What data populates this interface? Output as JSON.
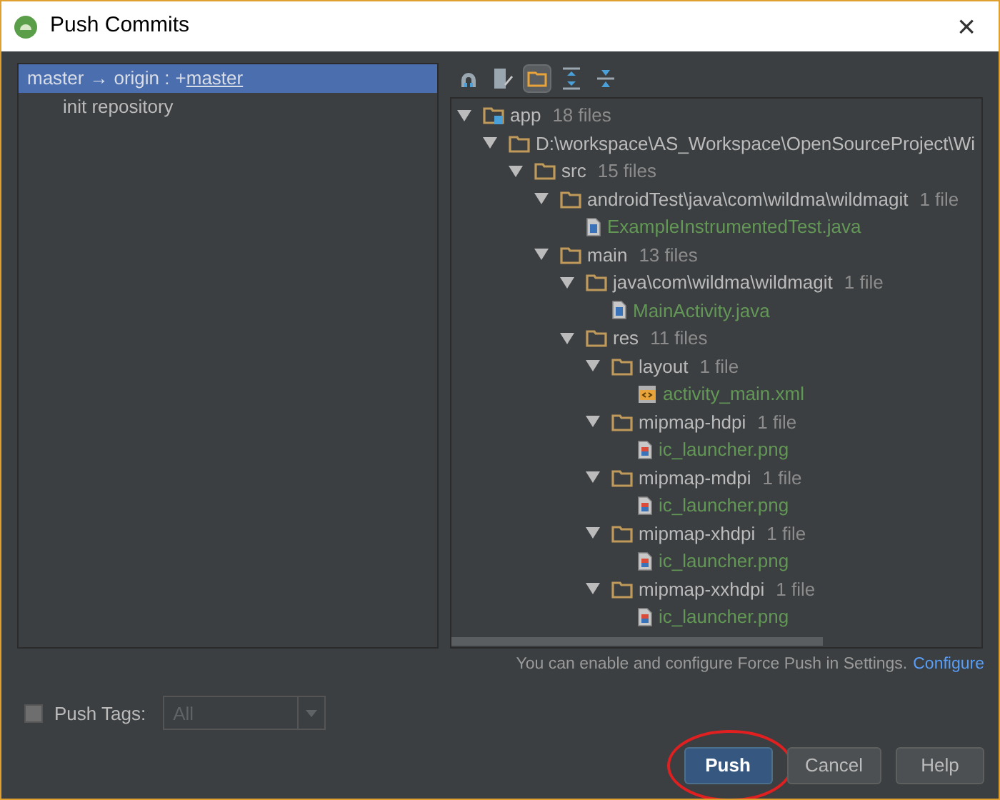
{
  "window": {
    "title": "Push Commits",
    "close": "×"
  },
  "commits": [
    {
      "kind": "branch",
      "parts": [
        "master",
        "→",
        "origin :",
        "+"
      ],
      "link": "master",
      "selected": true
    },
    {
      "kind": "commit",
      "text": "init repository",
      "selected": false
    }
  ],
  "toolbar": [
    {
      "kind": "cloud",
      "selected": false
    },
    {
      "kind": "edit",
      "selected": false
    },
    {
      "kind": "group",
      "selected": true
    },
    {
      "kind": "expand",
      "selected": false
    },
    {
      "kind": "collapse",
      "selected": false
    }
  ],
  "tree": [
    {
      "kind": "module",
      "name": "app",
      "count": "18 files",
      "expanded": true,
      "children": [
        {
          "kind": "folder",
          "name": "D:\\workspace\\AS_Workspace\\OpenSourceProject\\Wi",
          "expanded": true,
          "children": [
            {
              "kind": "folder",
              "name": "src",
              "count": "15 files",
              "expanded": true,
              "children": [
                {
                  "kind": "folder",
                  "name": "androidTest\\java\\com\\wildma\\wildmagit",
                  "count": "1 file",
                  "expanded": true,
                  "children": [
                    {
                      "kind": "java",
                      "name": "ExampleInstrumentedTest.java"
                    }
                  ]
                },
                {
                  "kind": "folder",
                  "name": "main",
                  "count": "13 files",
                  "expanded": true,
                  "children": [
                    {
                      "kind": "folder",
                      "name": "java\\com\\wildma\\wildmagit",
                      "count": "1 file",
                      "expanded": true,
                      "children": [
                        {
                          "kind": "java",
                          "name": "MainActivity.java"
                        }
                      ]
                    },
                    {
                      "kind": "folder",
                      "name": "res",
                      "count": "11 files",
                      "expanded": true,
                      "children": [
                        {
                          "kind": "folder",
                          "name": "layout",
                          "count": "1 file",
                          "expanded": true,
                          "children": [
                            {
                              "kind": "xml",
                              "name": "activity_main.xml"
                            }
                          ]
                        },
                        {
                          "kind": "folder",
                          "name": "mipmap-hdpi",
                          "count": "1 file",
                          "expanded": true,
                          "children": [
                            {
                              "kind": "png",
                              "name": "ic_launcher.png"
                            }
                          ]
                        },
                        {
                          "kind": "folder",
                          "name": "mipmap-mdpi",
                          "count": "1 file",
                          "expanded": true,
                          "children": [
                            {
                              "kind": "png",
                              "name": "ic_launcher.png"
                            }
                          ]
                        },
                        {
                          "kind": "folder",
                          "name": "mipmap-xhdpi",
                          "count": "1 file",
                          "expanded": true,
                          "children": [
                            {
                              "kind": "png",
                              "name": "ic_launcher.png"
                            }
                          ]
                        },
                        {
                          "kind": "folder",
                          "name": "mipmap-xxhdpi",
                          "count": "1 file",
                          "expanded": true,
                          "children": [
                            {
                              "kind": "png",
                              "name": "ic_launcher.png"
                            }
                          ]
                        }
                      ]
                    }
                  ]
                }
              ]
            }
          ]
        }
      ]
    }
  ],
  "force_push_note": {
    "text": "You can enable and configure Force Push in Settings.",
    "link": "Configure"
  },
  "push_tags": {
    "label": "Push Tags:",
    "checked": false,
    "value": "All",
    "disabled": true
  },
  "buttons": [
    {
      "label": "Push",
      "kind": "default",
      "circled": true
    },
    {
      "label": "Cancel",
      "kind": "normal",
      "circled": false
    },
    {
      "label": "Help",
      "kind": "normal",
      "circled": false
    }
  ]
}
